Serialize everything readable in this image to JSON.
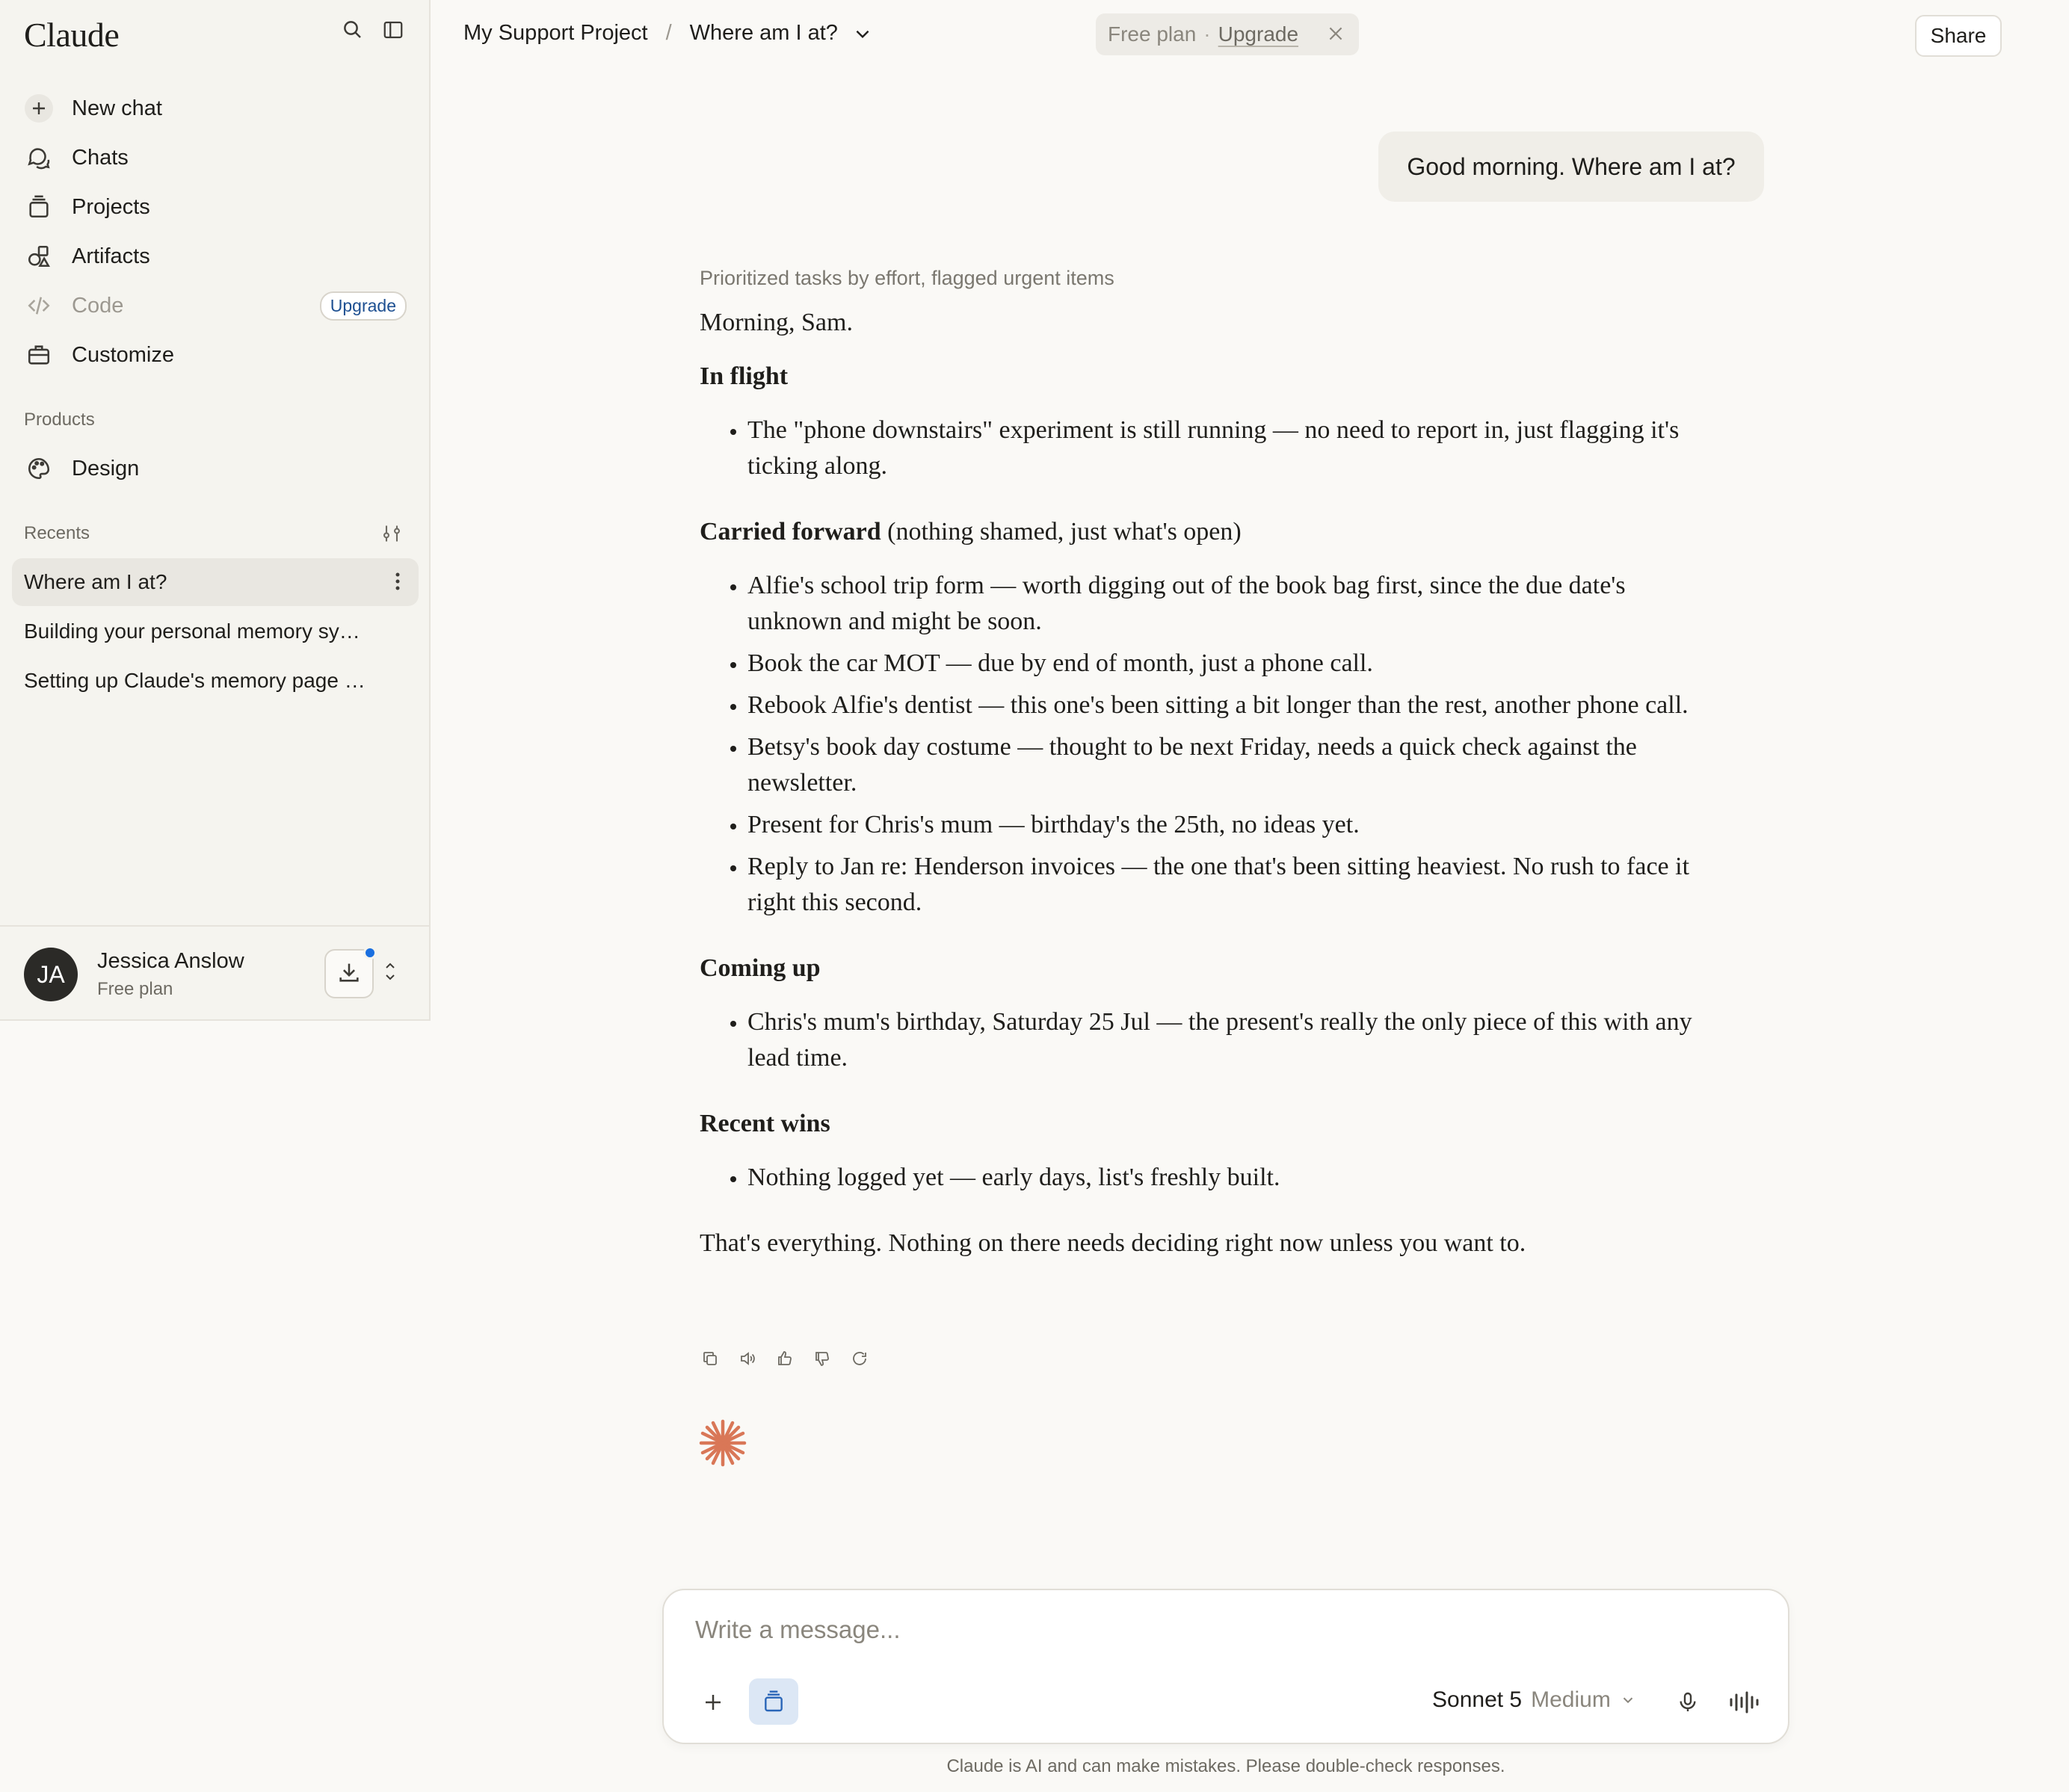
{
  "sidebar": {
    "logo": "Claude",
    "nav": [
      {
        "label": "New chat",
        "icon": "plus-icon"
      },
      {
        "label": "Chats",
        "icon": "chats-icon"
      },
      {
        "label": "Projects",
        "icon": "projects-icon"
      },
      {
        "label": "Artifacts",
        "icon": "artifacts-icon"
      },
      {
        "label": "Code",
        "icon": "code-icon",
        "badge": "Upgrade"
      },
      {
        "label": "Customize",
        "icon": "briefcase-icon"
      }
    ],
    "products_label": "Products",
    "products": [
      {
        "label": "Design",
        "icon": "palette-icon"
      }
    ],
    "recents_label": "Recents",
    "recents": [
      {
        "label": "Where am I at?",
        "active": true
      },
      {
        "label": "Building your personal memory sy…"
      },
      {
        "label": "Setting up Claude's memory page …"
      }
    ],
    "user": {
      "initials": "JA",
      "name": "Jessica Anslow",
      "plan": "Free plan"
    }
  },
  "header": {
    "project": "My Support Project",
    "separator": "/",
    "chat_title": "Where am I at?",
    "plan_banner": {
      "text": "Free plan",
      "dot": "·",
      "link": "Upgrade"
    },
    "share_label": "Share"
  },
  "conversation": {
    "user_message": "Good morning. Where am I at?",
    "thought_summary": "Prioritized tasks by effort, flagged urgent items",
    "greeting": "Morning, Sam.",
    "sections": [
      {
        "heading": "In flight",
        "note": "",
        "items": [
          "The \"phone downstairs\" experiment is still running — no need to report in, just flagging it's ticking along."
        ]
      },
      {
        "heading": "Carried forward",
        "note": "(nothing shamed, just what's open)",
        "items": [
          "Alfie's school trip form — worth digging out of the book bag first, since the due date's unknown and might be soon.",
          "Book the car MOT — due by end of month, just a phone call.",
          "Rebook Alfie's dentist — this one's been sitting a bit longer than the rest, another phone call.",
          "Betsy's book day costume — thought to be next Friday, needs a quick check against the newsletter.",
          "Present for Chris's mum — birthday's the 25th, no ideas yet.",
          "Reply to Jan re: Henderson invoices — the one that's been sitting heaviest. No rush to face it right this second."
        ]
      },
      {
        "heading": "Coming up",
        "note": "",
        "items": [
          "Chris's mum's birthday, Saturday 25 Jul — the present's really the only piece of this with any lead time."
        ]
      },
      {
        "heading": "Recent wins",
        "note": "",
        "items": [
          "Nothing logged yet — early days, list's freshly built."
        ]
      }
    ],
    "closing": "That's everything. Nothing on there needs deciding right now unless you want to."
  },
  "composer": {
    "placeholder": "Write a message...",
    "model": "Sonnet 5",
    "effort": "Medium"
  },
  "disclaimer": "Claude is AI and can make mistakes. Please double-check responses.",
  "colors": {
    "accent": "#d97757",
    "link": "#1d4f91",
    "notification": "#1a6fe0"
  }
}
